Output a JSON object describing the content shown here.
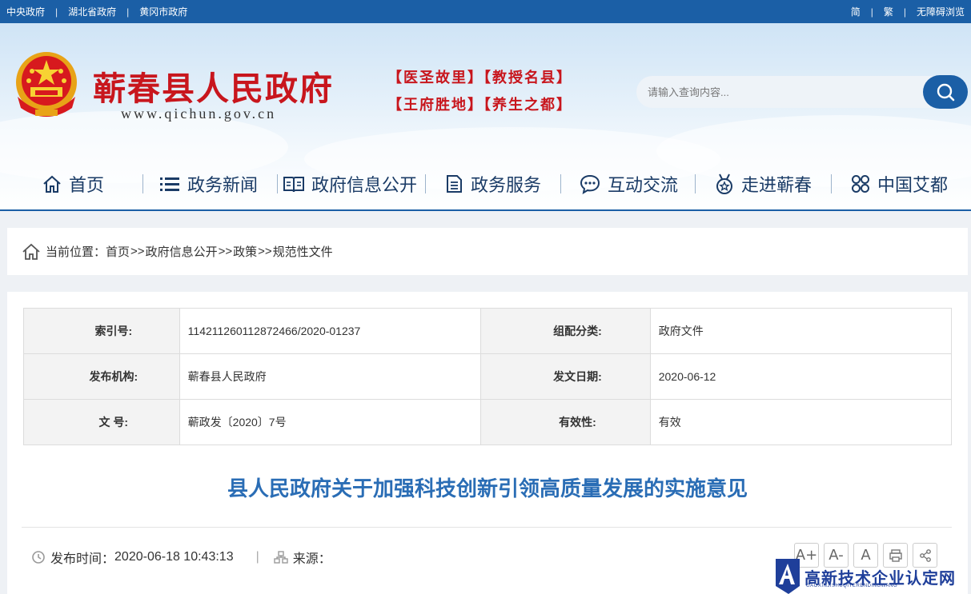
{
  "topbar": {
    "links_left": [
      "中央政府",
      "湖北省政府",
      "黄冈市政府"
    ],
    "links_right": [
      "简",
      "繁",
      "无障碍浏览"
    ]
  },
  "header": {
    "title": "蕲春县人民政府",
    "url": "www.qichun.gov.cn",
    "slogan_line1": "【医圣故里】【教授名县】",
    "slogan_line2": "【王府胜地】【养生之都】",
    "search_placeholder": "请输入查询内容..."
  },
  "nav": {
    "items": [
      {
        "label": "首页",
        "icon": "home-icon"
      },
      {
        "label": "政务新闻",
        "icon": "list-icon"
      },
      {
        "label": "政府信息公开",
        "icon": "book-icon"
      },
      {
        "label": "政务服务",
        "icon": "document-icon"
      },
      {
        "label": "互动交流",
        "icon": "chat-icon"
      },
      {
        "label": "走进蕲春",
        "icon": "badge-icon"
      },
      {
        "label": "中国艾都",
        "icon": "grid-circles-icon"
      }
    ]
  },
  "breadcrumb": {
    "prefix": "当前位置：",
    "items": [
      "首页",
      "政府信息公开",
      "政策",
      "规范性文件"
    ],
    "separator": ">>"
  },
  "meta": {
    "rows": [
      {
        "l1": "索引号:",
        "v1": "11421126011287246​6/2020-01237",
        "l2": "组配分类:",
        "v2": "政府文件"
      },
      {
        "l1": "发布机构:",
        "v1": "蕲春县人民政府",
        "l2": "发文日期:",
        "v2": "2020-06-12"
      },
      {
        "l1": "文 号:",
        "v1": "蕲政发〔2020〕7号",
        "l2": "有效性:",
        "v2": "有效"
      }
    ]
  },
  "article": {
    "title": "县人民政府关于加强科技创新引领高质量发展的实施意见",
    "publish_label": "发布时间：",
    "publish_time": "2020-06-18 10:43:13",
    "source_label": "来源："
  },
  "tools": [
    "A+",
    "A-",
    "A",
    "print-icon",
    "share-icon"
  ],
  "watermark": {
    "text": "高新技术企业认定网",
    "sub": "GAOXINJISHUQIYERENDINGWANG"
  },
  "colors": {
    "brand_blue": "#1b5fa6",
    "title_red": "#c8161d",
    "doc_title_blue": "#2a6db5"
  }
}
